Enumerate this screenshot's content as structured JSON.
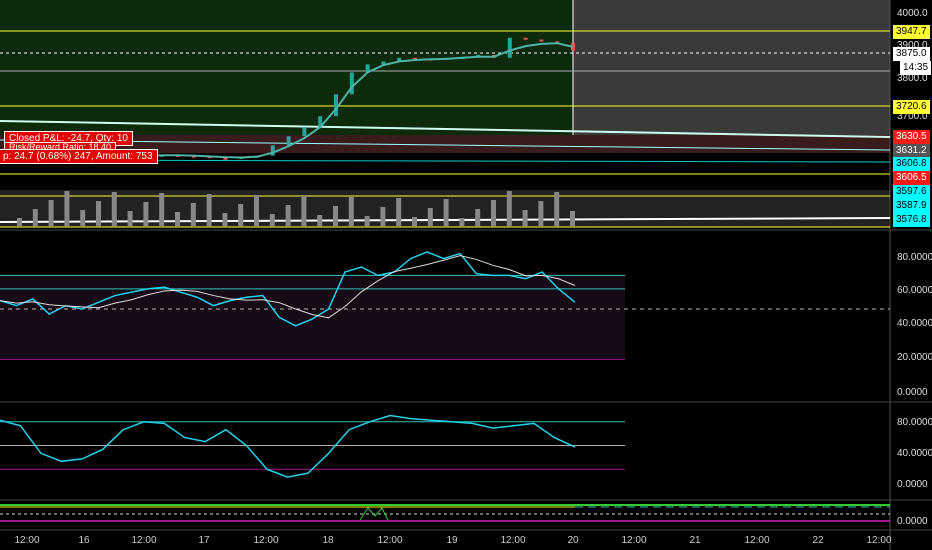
{
  "chart_data": {
    "type": "line",
    "title": "",
    "price_axis": [
      "4000.0",
      "3900.0",
      "3800.0",
      "3700.0"
    ],
    "price_levels": [
      {
        "label": "3947.7",
        "color": "#ffff33",
        "value": 3947.7
      },
      {
        "label": "3875.0",
        "color": "#ffffff",
        "value": 3875.0
      },
      {
        "label": "14:35",
        "color": "#ffffff",
        "value": 3855
      },
      {
        "label": "3720.6",
        "color": "#ffff33",
        "value": 3720.6
      },
      {
        "label": "3630.5",
        "color": "#ff1a1a",
        "value": 3630.5
      },
      {
        "label": "3631.2",
        "color": "#555555",
        "value": 3625
      },
      {
        "label": "3606.8",
        "color": "#00ffff",
        "value": 3606.8
      },
      {
        "label": "3606.5",
        "color": "#ff1a1a",
        "value": 3594
      },
      {
        "label": "3597.6",
        "color": "#00ffff",
        "value": 3580
      },
      {
        "label": "3587.9",
        "color": "#00ffff",
        "value": 3568
      },
      {
        "label": "3576.8",
        "color": "#00ffff",
        "value": 3556
      }
    ],
    "price_close": [
      3615,
      3612,
      3614,
      3613,
      3615,
      3616,
      3614,
      3613,
      3612,
      3614,
      3612,
      3611,
      3606,
      3604,
      3608,
      3612,
      3640,
      3665,
      3690,
      3720,
      3780,
      3840,
      3862,
      3870,
      3880,
      3878,
      3876,
      3880,
      3882,
      3888,
      3880,
      3935,
      3930,
      3925,
      3920,
      3900
    ],
    "price_ma": [
      3614,
      3614,
      3614,
      3614,
      3614,
      3614,
      3614,
      3614,
      3613,
      3613,
      3613,
      3612,
      3610,
      3608,
      3607,
      3609,
      3620,
      3638,
      3660,
      3690,
      3740,
      3800,
      3840,
      3860,
      3870,
      3874,
      3876,
      3877,
      3880,
      3883,
      3883,
      3900,
      3912,
      3918,
      3920,
      3910
    ],
    "rsi": {
      "axis": [
        "80.0000",
        "60.0000",
        "40.0000",
        "20.0000",
        "0.0000"
      ],
      "upper": 70,
      "lower": 20,
      "mid": 50,
      "values": [
        55,
        52,
        56,
        47,
        52,
        50,
        54,
        58,
        60,
        62,
        63,
        60,
        57,
        52,
        55,
        57,
        58,
        45,
        40,
        44,
        50,
        72,
        75,
        70,
        72,
        80,
        84,
        80,
        83,
        71,
        70,
        70,
        68,
        72,
        62,
        54
      ]
    },
    "stoch": {
      "axis": [
        "80.0000",
        "40.0000",
        "0.0000"
      ],
      "upper": 80,
      "lower": 20,
      "mid": 50,
      "values": [
        82,
        75,
        40,
        30,
        33,
        45,
        70,
        80,
        78,
        60,
        55,
        70,
        50,
        20,
        10,
        15,
        40,
        70,
        80,
        88,
        84,
        82,
        80,
        78,
        72,
        75,
        78,
        60,
        48
      ]
    },
    "x_ticks": [
      "12:00",
      "16",
      "12:00",
      "17",
      "12:00",
      "18",
      "12:00",
      "19",
      "12:00",
      "20",
      "12:00",
      "21",
      "12:00",
      "22",
      "12:00"
    ]
  },
  "trade_box": {
    "line1": "Closed P&L: -24.7, Qty: 10",
    "line2": "Risk/Reward Ratio: 18.40",
    "line3": "p: 24.7 (0.68%) 247, Amount: 753"
  }
}
